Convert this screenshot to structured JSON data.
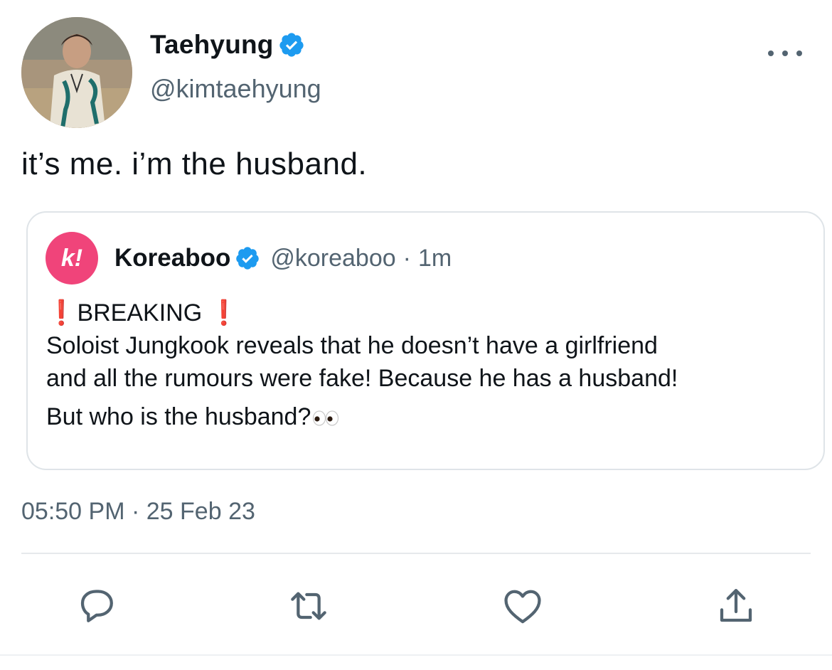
{
  "author": {
    "display_name": "Taehyung",
    "handle": "@kimtaehyung",
    "verified": true,
    "avatar_icon": "profile-photo"
  },
  "tweet": {
    "text": "it’s me. i’m the husband.",
    "time": "05:50 PM",
    "separator": "·",
    "date": "25 Feb 23"
  },
  "quoted_tweet": {
    "avatar_letter": "k!",
    "display_name": "Koreaboo",
    "verified": true,
    "handle": "@koreaboo",
    "separator": "·",
    "age": "1m",
    "headline": "BREAKING",
    "headline_emoji": "❗",
    "body_line_1": "Soloist Jungkook reveals that he doesn’t have a girlfriend",
    "body_line_2": "and all the rumours were fake! Because he has a husband!",
    "body_line_3": "But who is the husband?",
    "trailing_emoji": "eyes-emoji"
  },
  "actions": {
    "icons": [
      "reply-icon",
      "retweet-icon",
      "like-icon",
      "share-icon"
    ]
  },
  "colors": {
    "text_primary": "#0f1419",
    "text_secondary": "#536471",
    "verified_blue": "#1d9bf0",
    "koreaboo_pink": "#f0447a",
    "border": "#dfe4e8",
    "breaking_red": "#e0242e"
  }
}
